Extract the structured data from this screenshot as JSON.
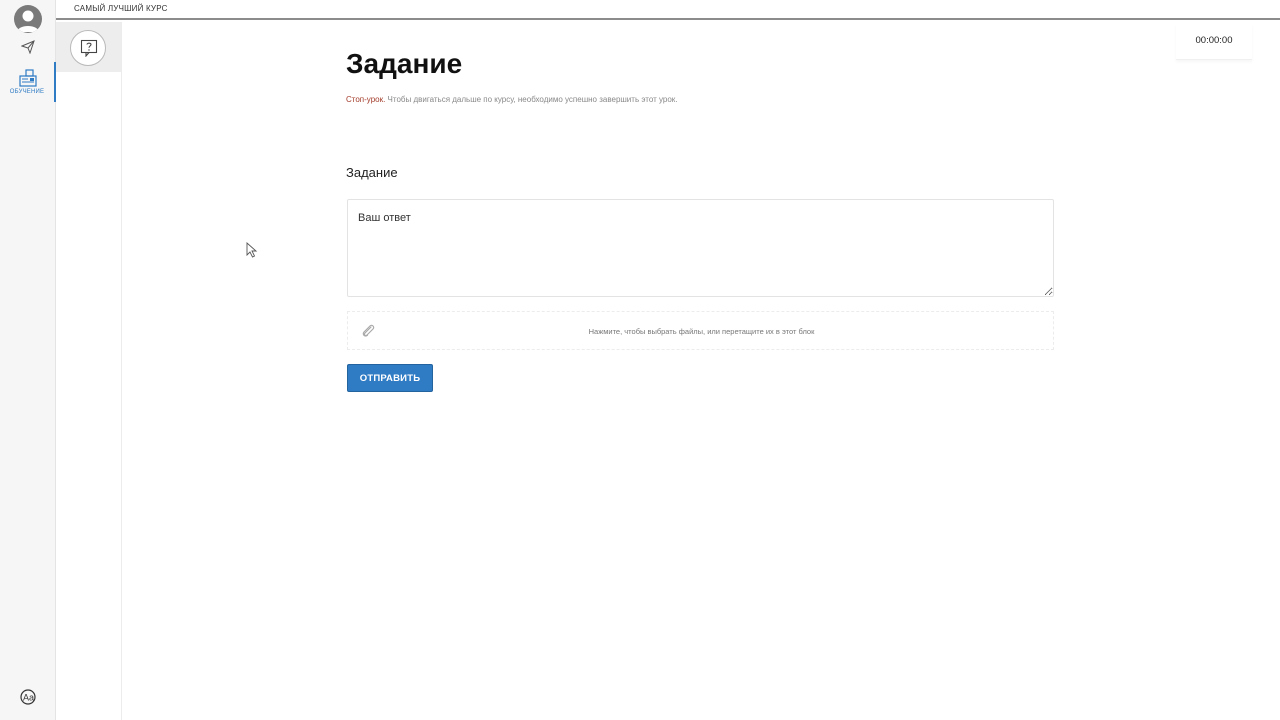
{
  "topbar": {
    "course_title": "САМЫЙ ЛУЧШИЙ КУРС"
  },
  "rail": {
    "items": [
      {
        "icon": "avatar-icon"
      },
      {
        "icon": "paper-plane-icon"
      },
      {
        "icon": "learning-icon",
        "label": "ОБУЧЕНИЕ",
        "active": true
      },
      {
        "icon": "font-size-icon"
      }
    ],
    "accent_color": "#2f7bc4"
  },
  "lesson_list": {
    "current_icon": "question-icon"
  },
  "main": {
    "title": "Задание",
    "stop_label": "Стоп-урок.",
    "stop_text": " Чтобы двигаться дальше по курсу, необходимо успешно завершить этот урок.",
    "section_title": "Задание",
    "answer_placeholder": "Ваш ответ",
    "dropzone_text": "Нажмите, чтобы выбрать файлы, или перетащите их в этот блок",
    "submit_label": "ОТПРАВИТЬ"
  },
  "timer": {
    "value": "00:00:00"
  }
}
